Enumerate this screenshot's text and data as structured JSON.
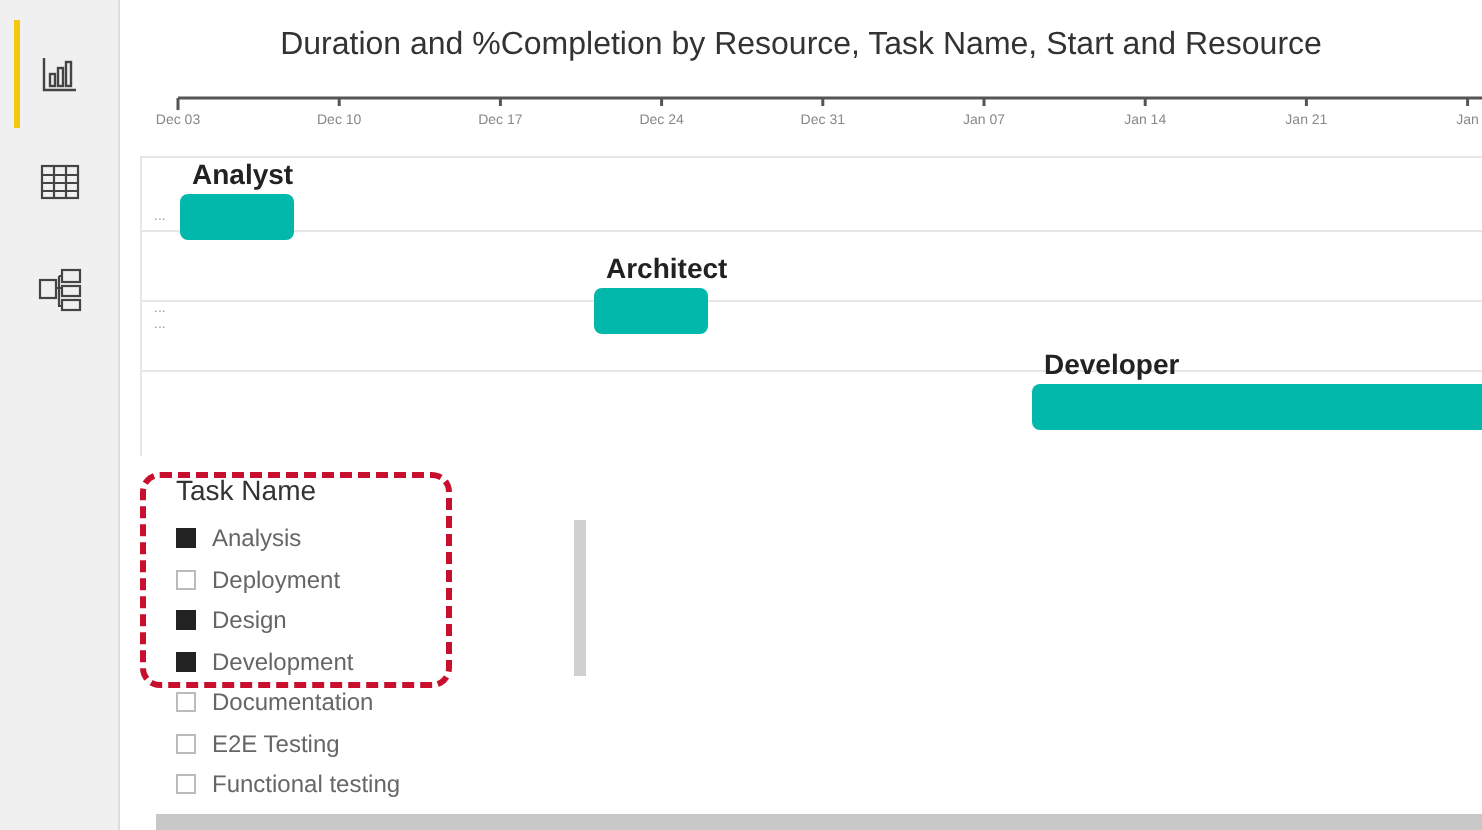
{
  "sidebar": {
    "items": [
      {
        "kind": "report",
        "selected": true
      },
      {
        "kind": "data",
        "selected": false
      },
      {
        "kind": "model",
        "selected": false
      }
    ]
  },
  "chart": {
    "title": "Duration and %Completion by Resource, Task Name, Start and Resource",
    "axis_ticks": [
      "Dec 03",
      "Dec 10",
      "Dec 17",
      "Dec 24",
      "Dec 31",
      "Jan 07",
      "Jan 14",
      "Jan 21",
      "Jan"
    ],
    "rows": [
      {
        "row_label": "...",
        "resource": "Analyst"
      },
      {
        "row_label": "...",
        "resource": "Architect"
      },
      {
        "row_label": "...",
        "resource": "Developer"
      }
    ]
  },
  "legend": {
    "title": "Task Name",
    "items": [
      {
        "label": "Analysis",
        "selected": true
      },
      {
        "label": "Deployment",
        "selected": false
      },
      {
        "label": "Design",
        "selected": true
      },
      {
        "label": "Development",
        "selected": true
      },
      {
        "label": "Documentation",
        "selected": false
      },
      {
        "label": "E2E Testing",
        "selected": false
      },
      {
        "label": "Functional testing",
        "selected": false
      }
    ]
  }
}
